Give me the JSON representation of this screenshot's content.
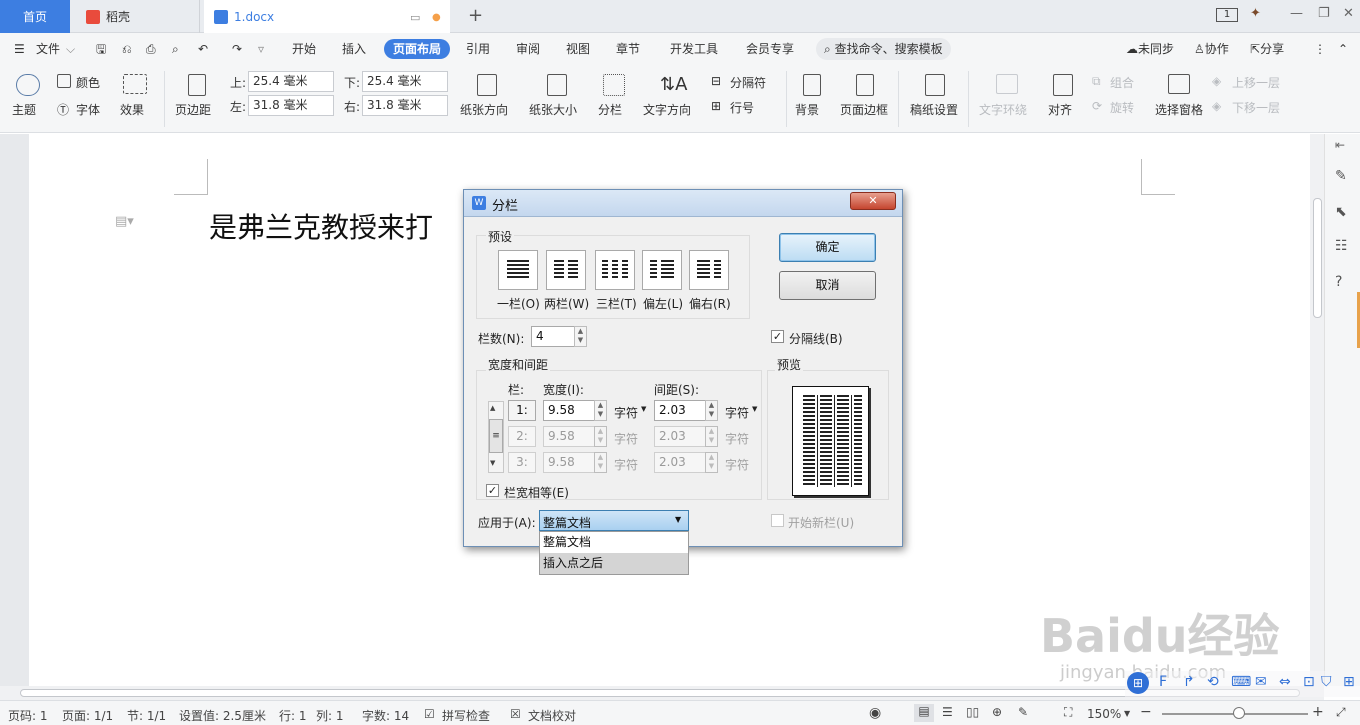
{
  "tabs": {
    "home": "首页",
    "daoke": "稻壳",
    "doc": "1.docx",
    "add": "+"
  },
  "window": {
    "page_indicator": "1"
  },
  "menu": {
    "file": "文件",
    "items": [
      "开始",
      "插入",
      "页面布局",
      "引用",
      "审阅",
      "视图",
      "章节",
      "开发工具",
      "会员专享"
    ],
    "active": "页面布局",
    "search": "查找命令、搜索模板",
    "sync": "未同步",
    "collab": "协作",
    "share": "分享"
  },
  "ribbon": {
    "theme": "主题",
    "color": "颜色",
    "font": "字体",
    "effect": "效果",
    "margin": "页边距",
    "top_label": "上:",
    "top_val": "25.4 毫米",
    "bottom_label": "下:",
    "bottom_val": "25.4 毫米",
    "left_label": "左:",
    "left_val": "31.8 毫米",
    "right_label": "右:",
    "right_val": "31.8 毫米",
    "orientation": "纸张方向",
    "size": "纸张大小",
    "columns": "分栏",
    "text_dir": "文字方向",
    "separator": "分隔符",
    "line_num": "行号",
    "background": "背景",
    "page_border": "页面边框",
    "manuscript": "稿纸设置",
    "text_wrap": "文字环绕",
    "align": "对齐",
    "group": "组合",
    "rotate": "旋转",
    "selection": "选择窗格",
    "bring_forward": "上移一层",
    "send_backward": "下移一层"
  },
  "document": {
    "text": "是弗兰克教授来打"
  },
  "dialog": {
    "title": "分栏",
    "preset_group": "预设",
    "presets": [
      "一栏(O)",
      "两栏(W)",
      "三栏(T)",
      "偏左(L)",
      "偏右(R)"
    ],
    "ok": "确定",
    "cancel": "取消",
    "num_cols_label": "栏数(N):",
    "num_cols": "4",
    "separator_label": "分隔线(B)",
    "width_group": "宽度和间距",
    "preview_group": "预览",
    "col_head": "栏:",
    "width_head": "宽度(I):",
    "spacing_head": "间距(S):",
    "rows": [
      {
        "col": "1:",
        "width": "9.58",
        "unit": "字符",
        "spacing": "2.03",
        "unit2": "字符"
      },
      {
        "col": "2:",
        "width": "9.58",
        "unit": "字符",
        "spacing": "2.03",
        "unit2": "字符"
      },
      {
        "col": "3:",
        "width": "9.58",
        "unit": "字符",
        "spacing": "2.03",
        "unit2": "字符"
      }
    ],
    "equal_width": "栏宽相等(E)",
    "apply_label": "应用于(A):",
    "apply_value": "整篇文档",
    "apply_options": [
      "整篇文档",
      "插入点之后"
    ],
    "new_col": "开始新栏(U)"
  },
  "status": {
    "page_num": "页码: 1",
    "pages": "页面: 1/1",
    "section": "节: 1/1",
    "setting": "设置值: 2.5厘米",
    "row": "行: 1",
    "col": "列: 1",
    "words": "字数: 14",
    "spell": "拼写检查",
    "proof": "文档校对",
    "zoom": "150%"
  },
  "watermark": {
    "brand": "Baidu经验",
    "url": "jingyan.baidu.com"
  }
}
